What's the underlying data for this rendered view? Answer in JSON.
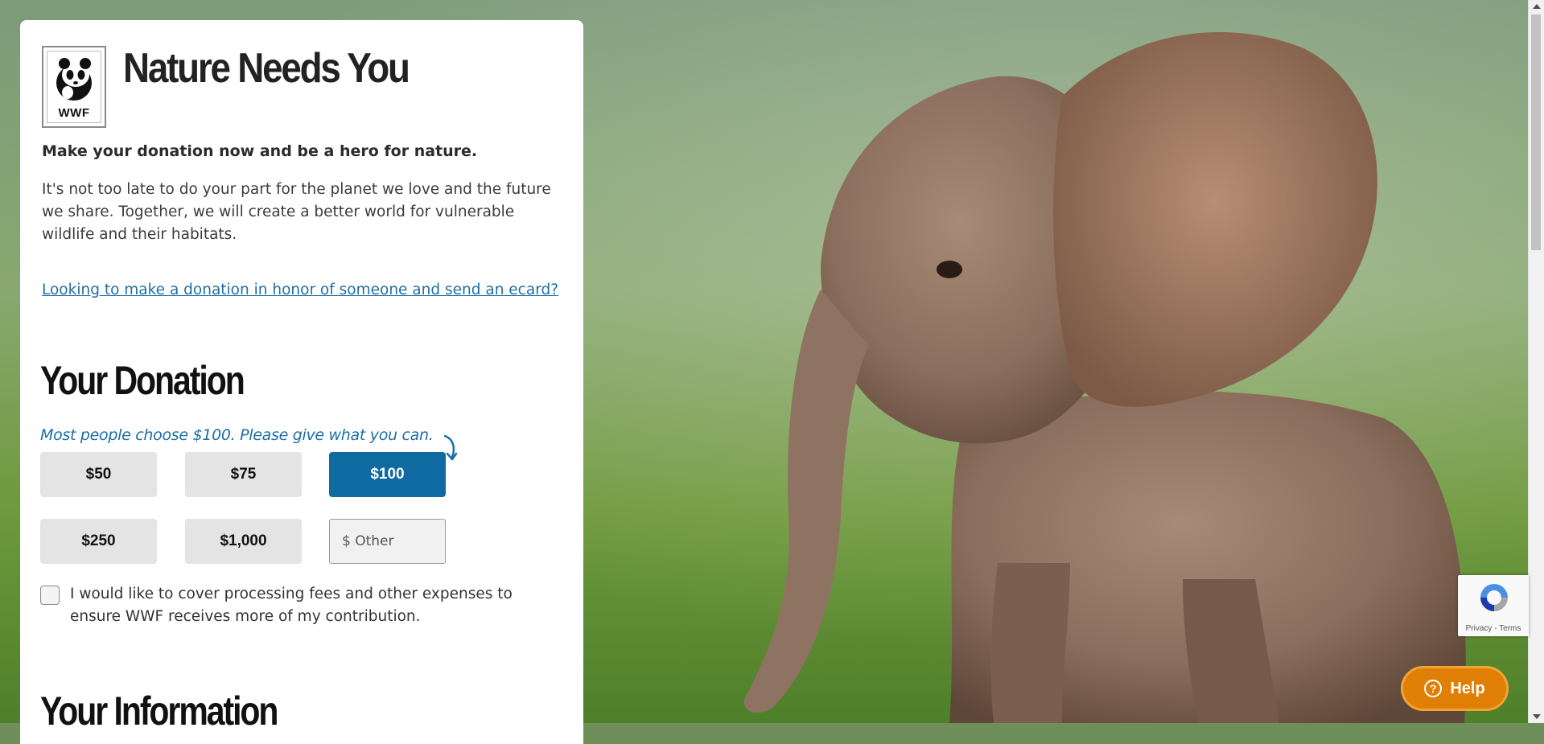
{
  "hero": {
    "title": "Nature Needs You",
    "logo_text": "WWF",
    "lead": "Make your donation now and be a hero for nature.",
    "body": "It's not too late to do your part for the planet we love and the future we share. Together, we will create a better world for vulnerable wildlife and their habitats.",
    "ecard_link": "Looking to make a donation in honor of someone and send an ecard?"
  },
  "donation": {
    "heading": "Your Donation",
    "hint": "Most people choose $100. Please give what you can.",
    "amounts": [
      "$50",
      "$75",
      "$100",
      "$250",
      "$1,000"
    ],
    "selected": "$100",
    "other_placeholder": "$ Other",
    "fees_label": "I would like to cover processing fees and other expenses to ensure WWF receives more of my contribution."
  },
  "information": {
    "heading": "Your Information"
  },
  "recaptcha": {
    "links": "Privacy - Terms"
  },
  "help": {
    "label": "Help",
    "icon_glyph": "?"
  },
  "colors": {
    "accent": "#0f6aa1",
    "link": "#1f6fa3",
    "help": "#e07f05"
  }
}
